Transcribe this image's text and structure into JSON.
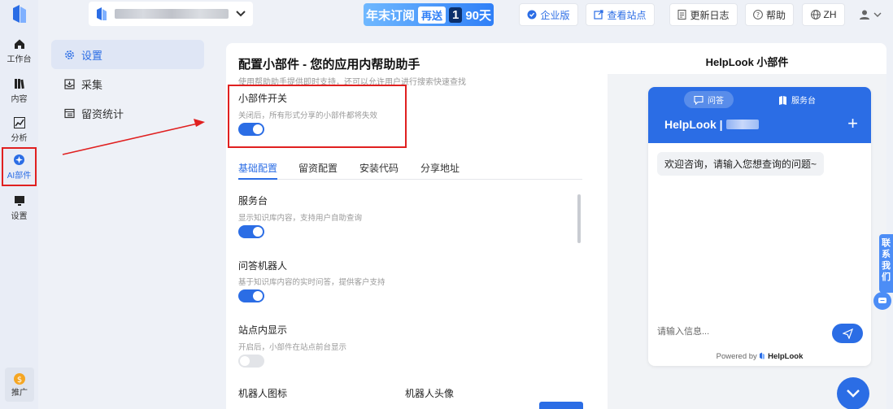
{
  "rail": {
    "items": [
      {
        "label": "工作台",
        "icon": "home-icon"
      },
      {
        "label": "内容",
        "icon": "books-icon"
      },
      {
        "label": "分析",
        "icon": "chart-icon"
      },
      {
        "label": "AI部件",
        "icon": "ai-widget-icon",
        "active": true
      },
      {
        "label": "设置",
        "icon": "monitor-icon"
      }
    ],
    "promo_label": "推广"
  },
  "topbar": {
    "promo": {
      "part1": "年末订阅",
      "tag": "再送",
      "digit": "1",
      "part2": "90天"
    },
    "enterprise": "企业版",
    "view_site": "查看站点",
    "changelog": "更新日志",
    "help": "帮助",
    "lang": "ZH"
  },
  "subnav": {
    "items": [
      {
        "label": "设置",
        "icon": "gear-icon",
        "active": true
      },
      {
        "label": "采集",
        "icon": "inbox-icon"
      },
      {
        "label": "留资统计",
        "icon": "table-icon"
      }
    ]
  },
  "config": {
    "title": "配置小部件 - 您的应用内帮助助手",
    "subtitle": "使用帮助助手提供即时支持，还可以允许用户进行搜索快速查找",
    "widget_switch": {
      "label": "小部件开关",
      "desc": "关闭后，所有形式分享的小部件都将失效",
      "on": true
    },
    "tabs": [
      "基础配置",
      "留资配置",
      "安装代码",
      "分享地址"
    ],
    "sections": [
      {
        "label": "服务台",
        "desc": "显示知识库内容，支持用户自助查询",
        "on": true
      },
      {
        "label": "问答机器人",
        "desc": "基于知识库内容的实时问答，提供客户支持",
        "on": true
      },
      {
        "label": "站点内显示",
        "desc": "开启后，小部件在站点前台显示",
        "on": false
      }
    ],
    "bot_icon_label": "机器人图标",
    "bot_avatar_label": "机器人头像"
  },
  "preview": {
    "title": "HelpLook 小部件",
    "tab_qa": "问答",
    "tab_service": "服务台",
    "brand": "HelpLook |",
    "greeting": "欢迎咨询，请输入您想查询的问题~",
    "input_placeholder": "请输入信息...",
    "powered_prefix": "Powered by",
    "powered_brand": "HelpLook"
  },
  "contact": {
    "label": "联系我们"
  },
  "colors": {
    "accent": "#2b6de5",
    "highlight": "#e02020"
  }
}
